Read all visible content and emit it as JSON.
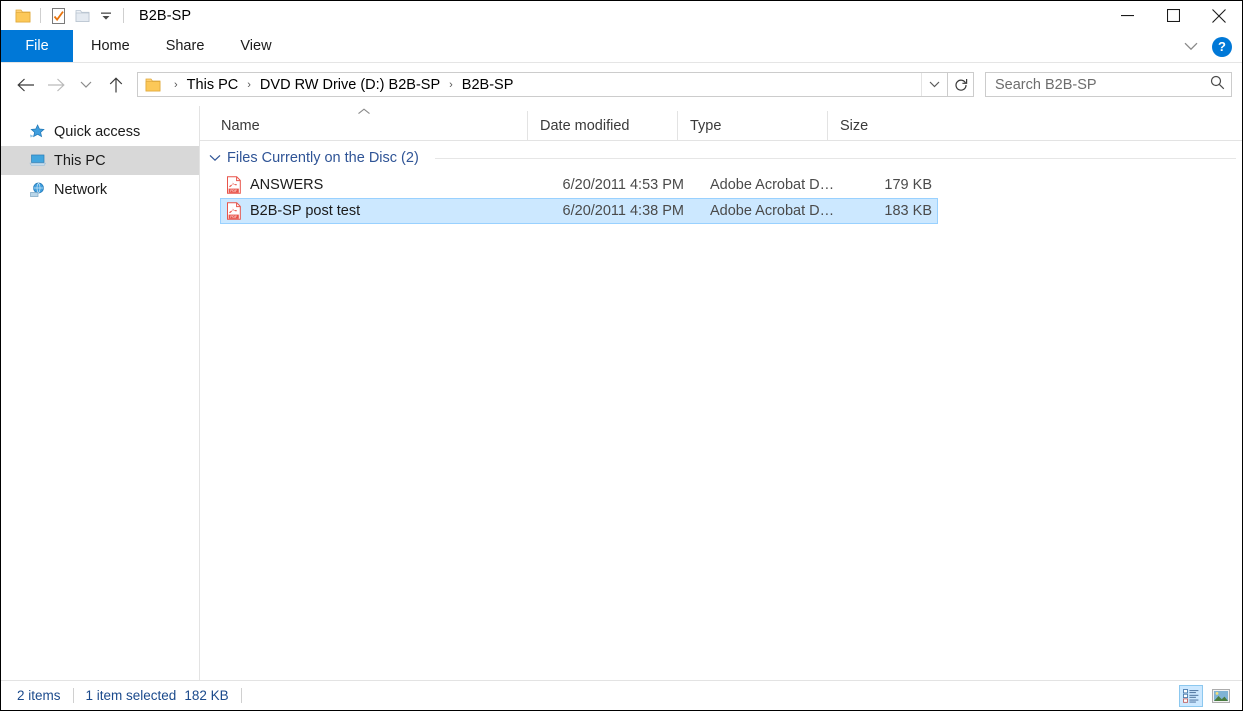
{
  "window": {
    "title": "B2B-SP",
    "quick_access": [
      {
        "name": "folder-icon",
        "label": "Explorer"
      },
      {
        "name": "properties-icon",
        "label": "Properties"
      },
      {
        "name": "new-folder-icon",
        "label": "New folder"
      },
      {
        "name": "customize-dropdown-icon",
        "label": "Customize Quick Access Toolbar"
      }
    ],
    "caption": {
      "minimize": "Minimize",
      "maximize": "Maximize",
      "close": "Close"
    }
  },
  "ribbon": {
    "tabs": [
      {
        "label": "File",
        "active": true
      },
      {
        "label": "Home",
        "active": false
      },
      {
        "label": "Share",
        "active": false
      },
      {
        "label": "View",
        "active": false
      }
    ],
    "expand_label": "Expand the Ribbon",
    "help_label": "?"
  },
  "address": {
    "back_label": "Back",
    "forward_label": "Forward",
    "recent_label": "Recent locations",
    "up_label": "Up",
    "breadcrumbs": [
      "This PC",
      "DVD RW Drive (D:) B2B-SP",
      "B2B-SP"
    ],
    "separator": "›",
    "dropdown_label": "Previous locations",
    "refresh_label": "Refresh"
  },
  "search": {
    "placeholder": "Search B2B-SP",
    "value": "",
    "icon": "search-icon"
  },
  "sidebar": {
    "items": [
      {
        "label": "Quick access",
        "icon": "star-icon",
        "selected": false
      },
      {
        "label": "This PC",
        "icon": "computer-icon",
        "selected": true
      },
      {
        "label": "Network",
        "icon": "network-icon",
        "selected": false
      }
    ]
  },
  "columns": [
    {
      "label": "Name",
      "sorted": "ascending"
    },
    {
      "label": "Date modified",
      "sorted": ""
    },
    {
      "label": "Type",
      "sorted": ""
    },
    {
      "label": "Size",
      "sorted": ""
    }
  ],
  "groups": [
    {
      "label": "Files Currently on the Disc (2)",
      "expanded": true,
      "rows": [
        {
          "name": "ANSWERS",
          "date_modified": "6/20/2011 4:53 PM",
          "type": "Adobe Acrobat D…",
          "size": "179 KB",
          "icon": "pdf-file-icon",
          "selected": false
        },
        {
          "name": "B2B-SP post test",
          "date_modified": "6/20/2011 4:38 PM",
          "type": "Adobe Acrobat D…",
          "size": "183 KB",
          "icon": "pdf-file-icon",
          "selected": true
        }
      ]
    }
  ],
  "status": {
    "item_count": "2 items",
    "selection": "1 item selected",
    "selection_size": "182 KB",
    "views": [
      {
        "name": "details-view-button",
        "label": "Details view",
        "active": true
      },
      {
        "name": "large-icons-view-button",
        "label": "Large icons view",
        "active": false
      }
    ]
  },
  "colors": {
    "accent": "#0078d7",
    "selection": "#cce8ff",
    "group_header": "#2f5496",
    "status_text": "#1b4a8c"
  }
}
